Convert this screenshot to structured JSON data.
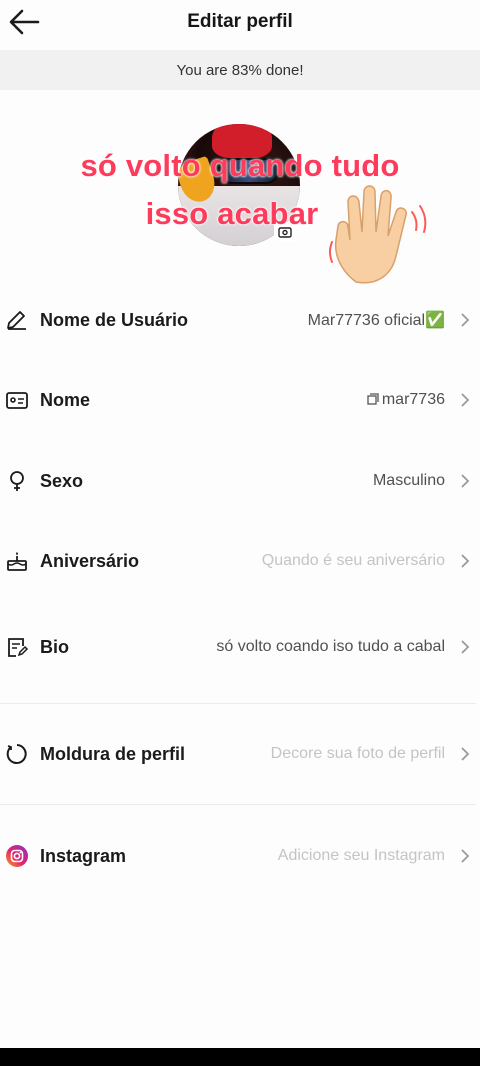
{
  "header": {
    "title": "Editar perfil",
    "back_icon": "arrow-left-icon"
  },
  "progress": {
    "text": "You are 83% done!",
    "percent": 83
  },
  "avatar": {
    "overlay_line1": "só volto quando tudo",
    "overlay_line2": "isso acabar",
    "badge_icon": "camera-icon"
  },
  "rows": [
    {
      "id": "username",
      "icon": "pencil-icon",
      "label": "Nome de Usuário",
      "value": "Mar77736 oficial✅",
      "placeholder": false
    },
    {
      "id": "name",
      "icon": "id-card-icon",
      "label": "Nome",
      "value_prefix_icon": "copy-icon",
      "value": "mar7736",
      "placeholder": false
    },
    {
      "id": "gender",
      "icon": "gender-icon",
      "label": "Sexo",
      "value": "Masculino",
      "placeholder": false
    },
    {
      "id": "birthday",
      "icon": "cake-icon",
      "label": "Aniversário",
      "value": "Quando é seu aniversário",
      "placeholder": true
    },
    {
      "id": "bio",
      "icon": "note-edit-icon",
      "label": "Bio",
      "value": "só volto coando iso tudo a cabal",
      "placeholder": false
    },
    {
      "id": "frame",
      "icon": "frame-icon",
      "label": "Moldura de perfil",
      "value": "Decore sua foto de perfil",
      "placeholder": true
    },
    {
      "id": "instagram",
      "icon": "instagram-icon",
      "label": "Instagram",
      "value": "Adicione seu Instagram",
      "placeholder": true
    }
  ],
  "colors": {
    "overlay_text": "#ff3b5c",
    "placeholder": "#c4c4c4",
    "banner_bg": "#f1f1f1"
  }
}
